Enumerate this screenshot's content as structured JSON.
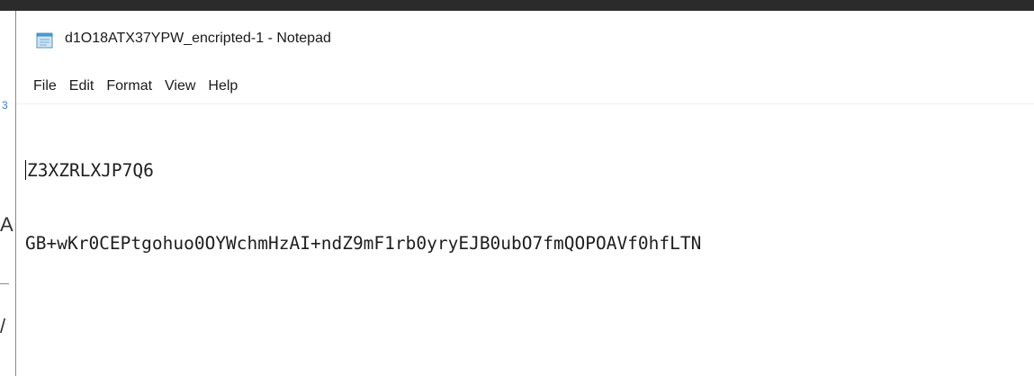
{
  "window": {
    "title": "d1O18ATX37YPW_encripted-1 - Notepad",
    "app_icon": "notepad-icon"
  },
  "menu": {
    "items": [
      {
        "label": "File"
      },
      {
        "label": "Edit"
      },
      {
        "label": "Format"
      },
      {
        "label": "View"
      },
      {
        "label": "Help"
      }
    ]
  },
  "editor": {
    "lines": [
      "Z3XZRLXJP7Q6",
      "GB+wKr0CEPtgohuo0OYWchmHzAI+ndZ9mF1rb0yryEJB0ubO7fmQOPOAVf0hfLTN"
    ]
  },
  "background": {
    "left_number": "3",
    "left_glyph_1": "A",
    "left_glyph_2": "/"
  }
}
